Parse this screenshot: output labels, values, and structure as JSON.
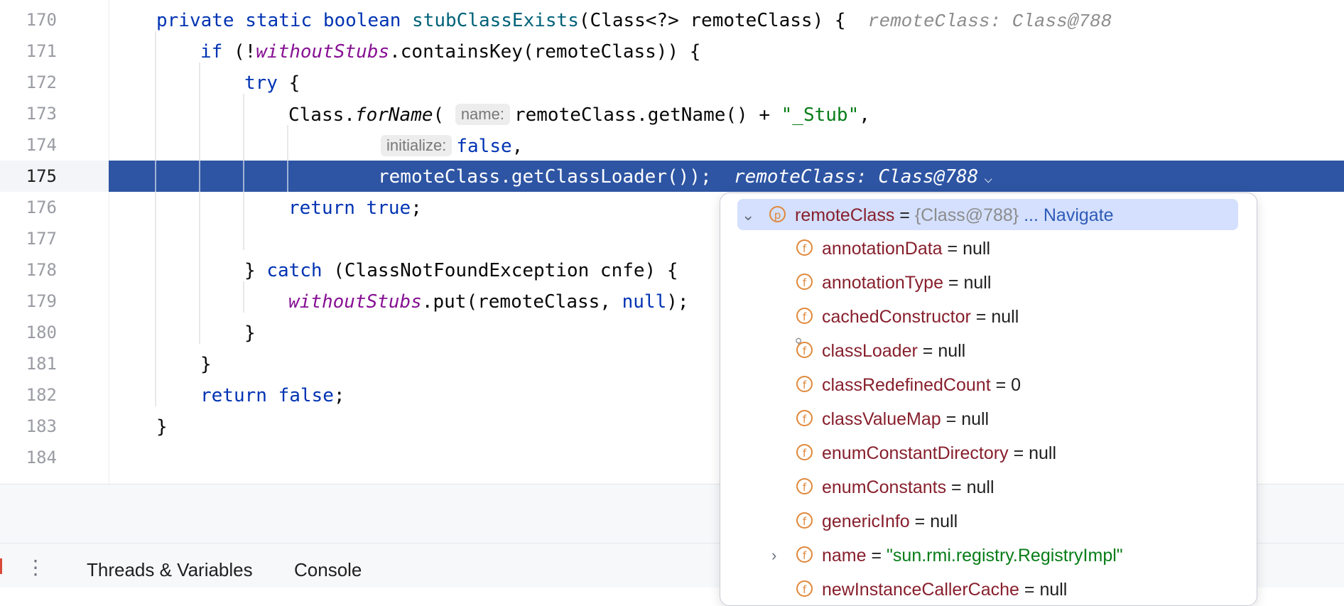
{
  "editor": {
    "lines": [
      {
        "num": "170"
      },
      {
        "num": "171"
      },
      {
        "num": "172"
      },
      {
        "num": "173"
      },
      {
        "num": "174"
      },
      {
        "num": "175"
      },
      {
        "num": "176"
      },
      {
        "num": "177"
      },
      {
        "num": "178"
      },
      {
        "num": "179"
      },
      {
        "num": "180"
      },
      {
        "num": "181"
      },
      {
        "num": "182"
      },
      {
        "num": "183"
      },
      {
        "num": "184"
      }
    ],
    "l170": {
      "private": "private",
      "static": "static",
      "boolean": "boolean",
      "method": "stubClassExists",
      "sig": "(Class<?> remoteClass) {",
      "hint": "remoteClass: Class@788"
    },
    "l171": {
      "if": "if",
      "open": " (!",
      "field": "withoutStubs",
      "rest": ".containsKey(remoteClass)) {"
    },
    "l172": {
      "try": "try",
      "rest": " {"
    },
    "l173": {
      "cls": "Class.",
      "method": "forName",
      "open": "(",
      "hint": "name:",
      "expr": "remoteClass.getName() + ",
      "str": "\"_Stub\"",
      "comma": ","
    },
    "l174": {
      "hint": "initialize:",
      "val": "false",
      "comma": ","
    },
    "l175": {
      "code": "remoteClass.getClassLoader());",
      "hint": "remoteClass: Class@788",
      "chevron": "⌵"
    },
    "l176": {
      "return": "return",
      "true": "true",
      "semi": ";"
    },
    "l178": {
      "close": "} ",
      "catch": "catch",
      "rest": " (ClassNotFoundException cnfe) {"
    },
    "l179": {
      "field": "withoutStubs",
      "mid": ".put(remoteClass, ",
      "null": "null",
      "end": ");"
    },
    "l180": {
      "brace": "}"
    },
    "l181": {
      "brace": "}"
    },
    "l182": {
      "return": "return",
      "false": "false",
      "semi": ";"
    },
    "l183": {
      "brace": "}"
    }
  },
  "popup": {
    "root": {
      "expander": "⌄",
      "badge": "p",
      "name": "remoteClass",
      "eq": " = ",
      "value": "{Class@788}",
      "link": "... Navigate"
    },
    "fields": [
      {
        "badge": "f",
        "name": "annotationData",
        "eq": " = ",
        "value": "null"
      },
      {
        "badge": "f",
        "name": "annotationType",
        "eq": " = ",
        "value": "null"
      },
      {
        "badge": "f",
        "name": "cachedConstructor",
        "eq": " = ",
        "value": "null"
      },
      {
        "badge": "f",
        "name": "classLoader",
        "eq": " = ",
        "value": "null"
      },
      {
        "badge": "f",
        "name": "classRedefinedCount",
        "eq": " = ",
        "value": "0"
      },
      {
        "badge": "f",
        "name": "classValueMap",
        "eq": " = ",
        "value": "null"
      },
      {
        "badge": "f",
        "name": "enumConstantDirectory",
        "eq": " = ",
        "value": "null"
      },
      {
        "badge": "f",
        "name": "enumConstants",
        "eq": " = ",
        "value": "null"
      },
      {
        "badge": "f",
        "name": "genericInfo",
        "eq": " = ",
        "value": "null"
      },
      {
        "badge": "f",
        "name": "name",
        "eq": " = ",
        "value": "\"sun.rmi.registry.RegistryImpl\"",
        "expander": "›"
      },
      {
        "badge": "f",
        "name": "newInstanceCallerCache",
        "eq": " = ",
        "value": "null"
      }
    ]
  },
  "bottom": {
    "kebab": "⋮",
    "tabs": [
      {
        "label": "Threads & Variables"
      },
      {
        "label": "Console"
      }
    ]
  },
  "colors": {
    "current_line": "#2e55a3",
    "keyword": "#0033b3",
    "static_field": "#871094",
    "string": "#067d17",
    "field_badge": "#e0883a"
  }
}
